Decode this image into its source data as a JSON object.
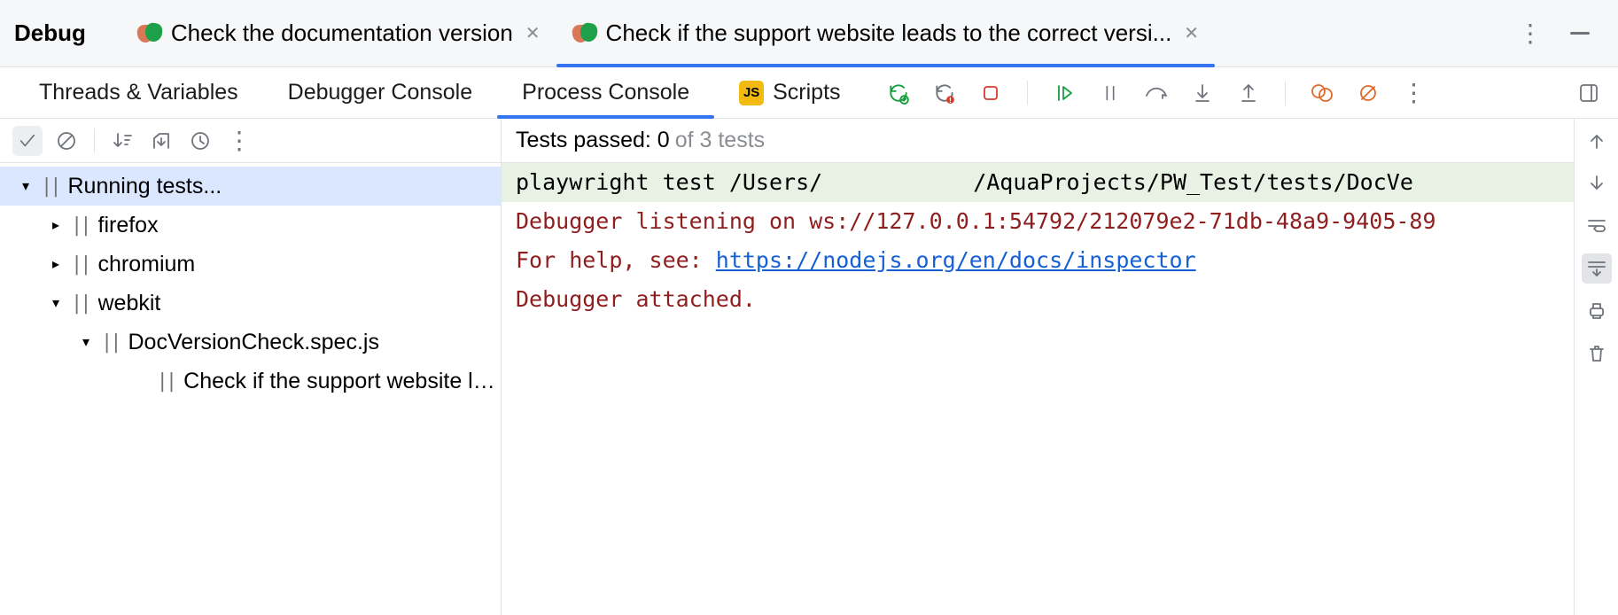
{
  "topbar": {
    "title": "Debug",
    "tabs": [
      {
        "label": "Check the documentation version",
        "active": false
      },
      {
        "label": "Check if the support website leads to the correct versi...",
        "active": true
      }
    ]
  },
  "sub_tabs": [
    {
      "label": "Threads & Variables",
      "active": false,
      "icon": null
    },
    {
      "label": "Debugger Console",
      "active": false,
      "icon": null
    },
    {
      "label": "Process Console",
      "active": true,
      "icon": null
    },
    {
      "label": "Scripts",
      "active": false,
      "icon": "js"
    }
  ],
  "debug_actions": {
    "rerun": "rerun-icon",
    "rerun_err": "rerun-failed-icon",
    "stop": "stop-icon",
    "resume": "resume-icon",
    "pause": "pause-icon",
    "step_over": "step-over-icon",
    "step_into": "step-into-icon",
    "step_out": "step-out-icon",
    "bp_view": "view-breakpoints-icon",
    "bp_mute": "mute-breakpoints-icon",
    "more": "more-icon"
  },
  "left_toolbar": {
    "check": "✓",
    "skip": "⊘",
    "sort": "sort-icon",
    "import": "import-icon",
    "history": "history-icon",
    "more": "⋮"
  },
  "tree": [
    {
      "level": 0,
      "arrow": "▾",
      "status": "||",
      "label": "Running tests...",
      "selected": true
    },
    {
      "level": 1,
      "arrow": "▸",
      "status": "||",
      "label": "firefox"
    },
    {
      "level": 1,
      "arrow": "▸",
      "status": "||",
      "label": "chromium"
    },
    {
      "level": 1,
      "arrow": "▾",
      "status": "||",
      "label": "webkit"
    },
    {
      "level": 2,
      "arrow": "▾",
      "status": "||",
      "label": "DocVersionCheck.spec.js"
    },
    {
      "level": 3,
      "arrow": "",
      "status": "||",
      "label": "Check if the support website leads"
    }
  ],
  "tests_status": {
    "prefix": "Tests passed: 0",
    "suffix": "of 3 tests"
  },
  "console": {
    "line1_a": "playwright test /Users/",
    "line1_b": "/AquaProjects/PW_Test/tests/DocVe",
    "line2": "Debugger listening on ws://127.0.0.1:54792/212079e2-71db-48a9-9405-89",
    "line3_a": "For help, see: ",
    "line3_link": "https://nodejs.org/en/docs/inspector",
    "line4": "Debugger attached."
  },
  "gutter": {
    "up": "↑",
    "down": "↓",
    "softwrap": "soft-wrap-icon",
    "scroll": "scroll-to-end-icon",
    "print": "print-icon",
    "clear": "clear-icon"
  }
}
